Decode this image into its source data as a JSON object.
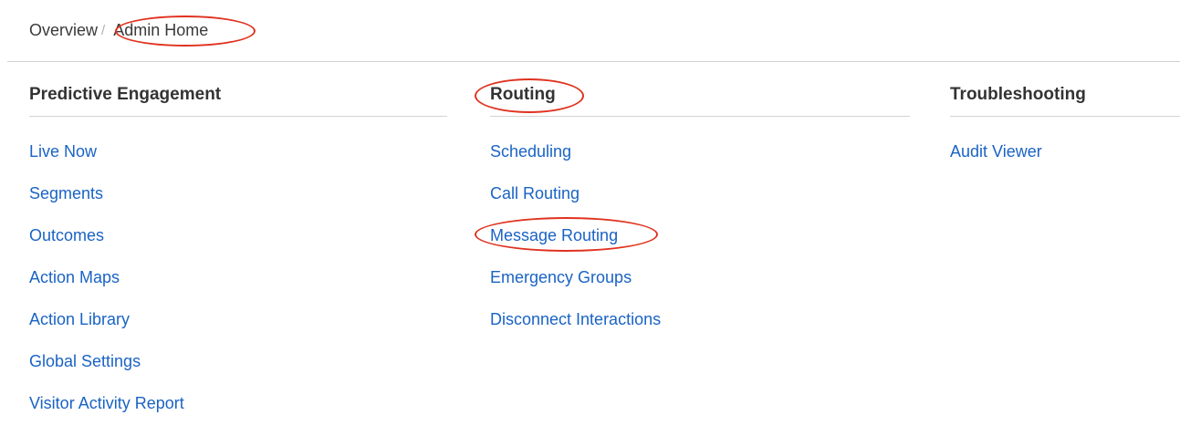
{
  "breadcrumb": {
    "items": [
      "Overview",
      "Admin Home"
    ],
    "separator": "/"
  },
  "columns": [
    {
      "heading": "Predictive Engagement",
      "links": [
        "Live Now",
        "Segments",
        "Outcomes",
        "Action Maps",
        "Action Library",
        "Global Settings",
        "Visitor Activity Report"
      ]
    },
    {
      "heading": "Routing",
      "links": [
        "Scheduling",
        "Call Routing",
        "Message Routing",
        "Emergency Groups",
        "Disconnect Interactions"
      ]
    },
    {
      "heading": "Troubleshooting",
      "links": [
        "Audit Viewer"
      ]
    }
  ],
  "colors": {
    "link": "#1a63c4",
    "annotation": "#e0321f",
    "heading": "#333333"
  }
}
